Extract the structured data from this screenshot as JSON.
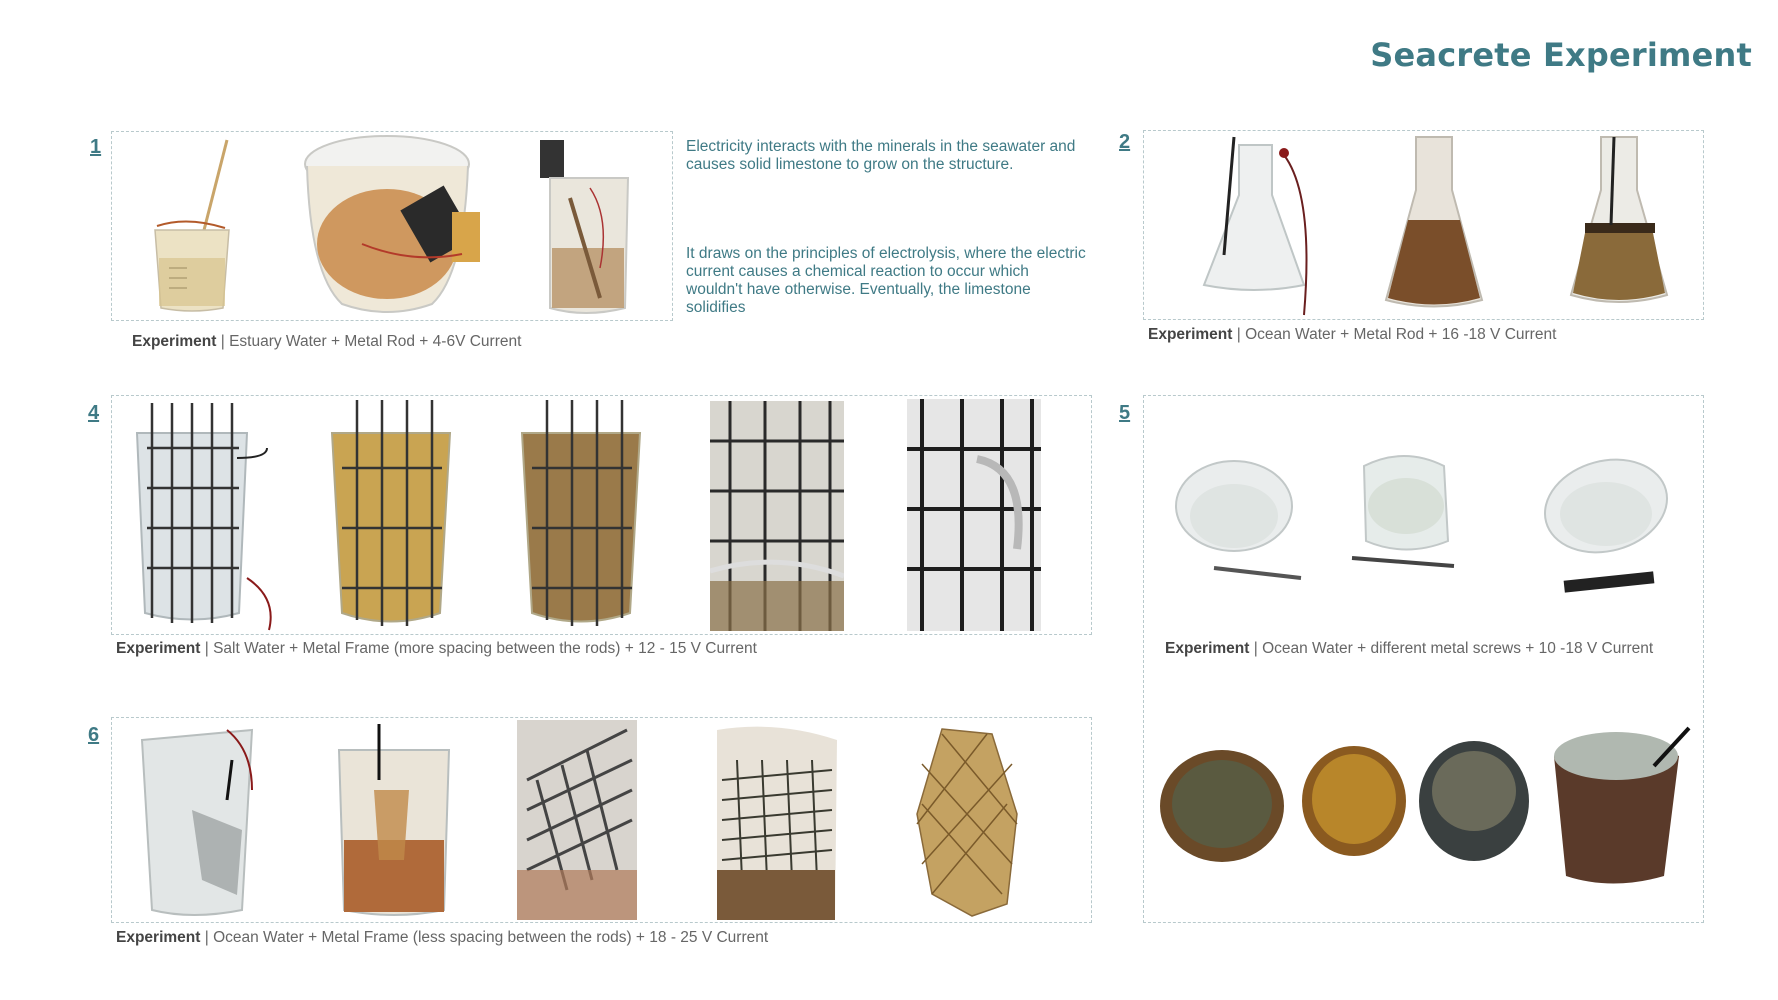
{
  "page": {
    "title": "Seacrete Experiment"
  },
  "experiments": [
    {
      "number": "1",
      "caption_label": "Experiment",
      "caption_separator": "|",
      "caption_text": "Estuary Water + Metal Rod + 4-6V Current",
      "description": [
        "Electricity interacts with the minerals in the seawater and causes solid limestone to grow on the structure.",
        "It draws on the principles of electrolysis, where the electric current causes a chemical reaction to occur which wouldn't have otherwise. Eventually, the limestone solidifies"
      ]
    },
    {
      "number": "2",
      "caption_label": "Experiment",
      "caption_separator": "|",
      "caption_text": "Ocean Water + Metal Rod + 16 -18 V Current"
    },
    {
      "number": "4",
      "caption_label": "Experiment",
      "caption_separator": "|",
      "caption_text": "Salt Water + Metal Frame (more spacing between the rods) + 12 -  15 V Current"
    },
    {
      "number": "5",
      "caption_label": "Experiment",
      "caption_separator": "|",
      "caption_text": "Ocean Water + different metal screws + 10 -18 V Current"
    },
    {
      "number": "6",
      "caption_label": "Experiment",
      "caption_separator": "|",
      "caption_text": "Ocean Water + Metal Frame (less spacing between the rods) + 18 -  25 V Current"
    }
  ],
  "colors": {
    "accent": "#3f7a85",
    "border": "#b8c9cc",
    "caption": "#666666"
  }
}
